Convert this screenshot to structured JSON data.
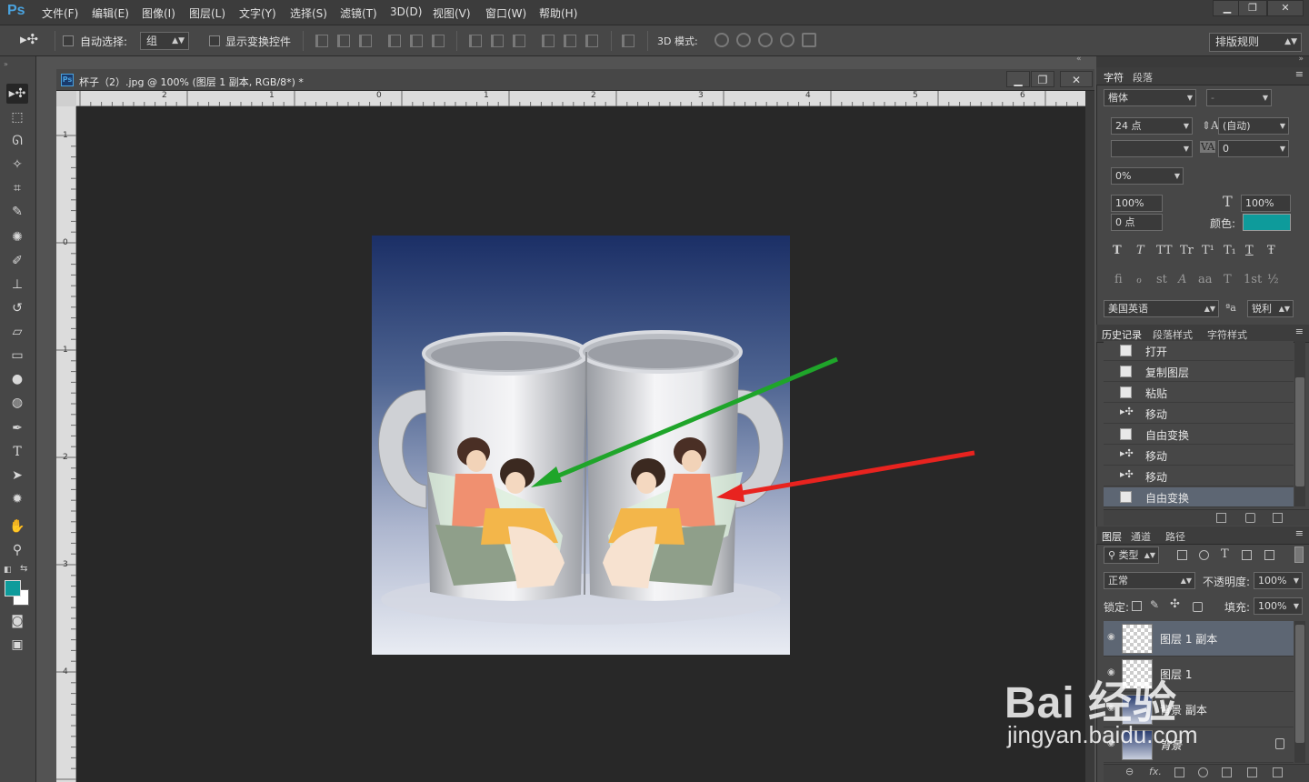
{
  "app": {
    "logo": "Ps",
    "menus": [
      "文件(F)",
      "编辑(E)",
      "图像(I)",
      "图层(L)",
      "文字(Y)",
      "选择(S)",
      "滤镜(T)",
      "3D(D)",
      "视图(V)",
      "窗口(W)",
      "帮助(H)"
    ],
    "window_buttons": {
      "minimize": "▁",
      "restore": "❐",
      "close": "✕"
    }
  },
  "options": {
    "auto_select_label": "自动选择:",
    "auto_select_value": "组",
    "show_transform_label": "显示变换控件",
    "mode_3d_label": "3D 模式:",
    "workspace": "排版规则"
  },
  "document": {
    "title": "杯子（2）.jpg @ 100% (图层 1 副本, RGB/8*) *",
    "ruler_top": [
      "2",
      "1",
      "0",
      "1",
      "2",
      "3",
      "4",
      "5",
      "6"
    ],
    "ruler_left": [
      "1",
      "0",
      "1",
      "2",
      "3",
      "4"
    ]
  },
  "character_panel": {
    "tabs": [
      "字符",
      "段落"
    ],
    "font_family": "楷体",
    "font_style": "-",
    "font_size": "24 点",
    "leading": "(自动)",
    "kerning": "",
    "tracking": "0",
    "baseline_percent": "0%",
    "vertical_scale": "100%",
    "horizontal_scale": "100%",
    "baseline_shift": "0 点",
    "color_label": "颜色:",
    "text_color": "#0e9b9b",
    "style_glyphs": [
      "T",
      "T",
      "TT",
      "Tr",
      "T¹",
      "T₁",
      "T",
      "Ŧ"
    ],
    "opentype_glyphs": [
      "fi",
      "ℴ",
      "st",
      "A",
      "aa",
      "T",
      "1st",
      "½"
    ],
    "language": "美国英语",
    "aa_label": "ªa",
    "antialias": "锐利"
  },
  "history_panel": {
    "tabs": [
      "历史记录",
      "段落样式",
      "字符样式"
    ],
    "items": [
      "打开",
      "复制图层",
      "粘贴",
      "移动",
      "自由变换",
      "移动",
      "移动",
      "自由变换"
    ]
  },
  "layers_panel": {
    "tabs": [
      "图层",
      "通道",
      "路径"
    ],
    "filter_type": "类型",
    "blend_mode": "正常",
    "opacity_label": "不透明度:",
    "opacity": "100%",
    "lock_label": "锁定:",
    "fill_label": "填充:",
    "fill": "100%",
    "layers": [
      "图层 1 副本",
      "图层 1",
      "背景 副本",
      "背景"
    ]
  },
  "watermark": {
    "brand": "Bai 经验",
    "url": "jingyan.baidu.com"
  }
}
